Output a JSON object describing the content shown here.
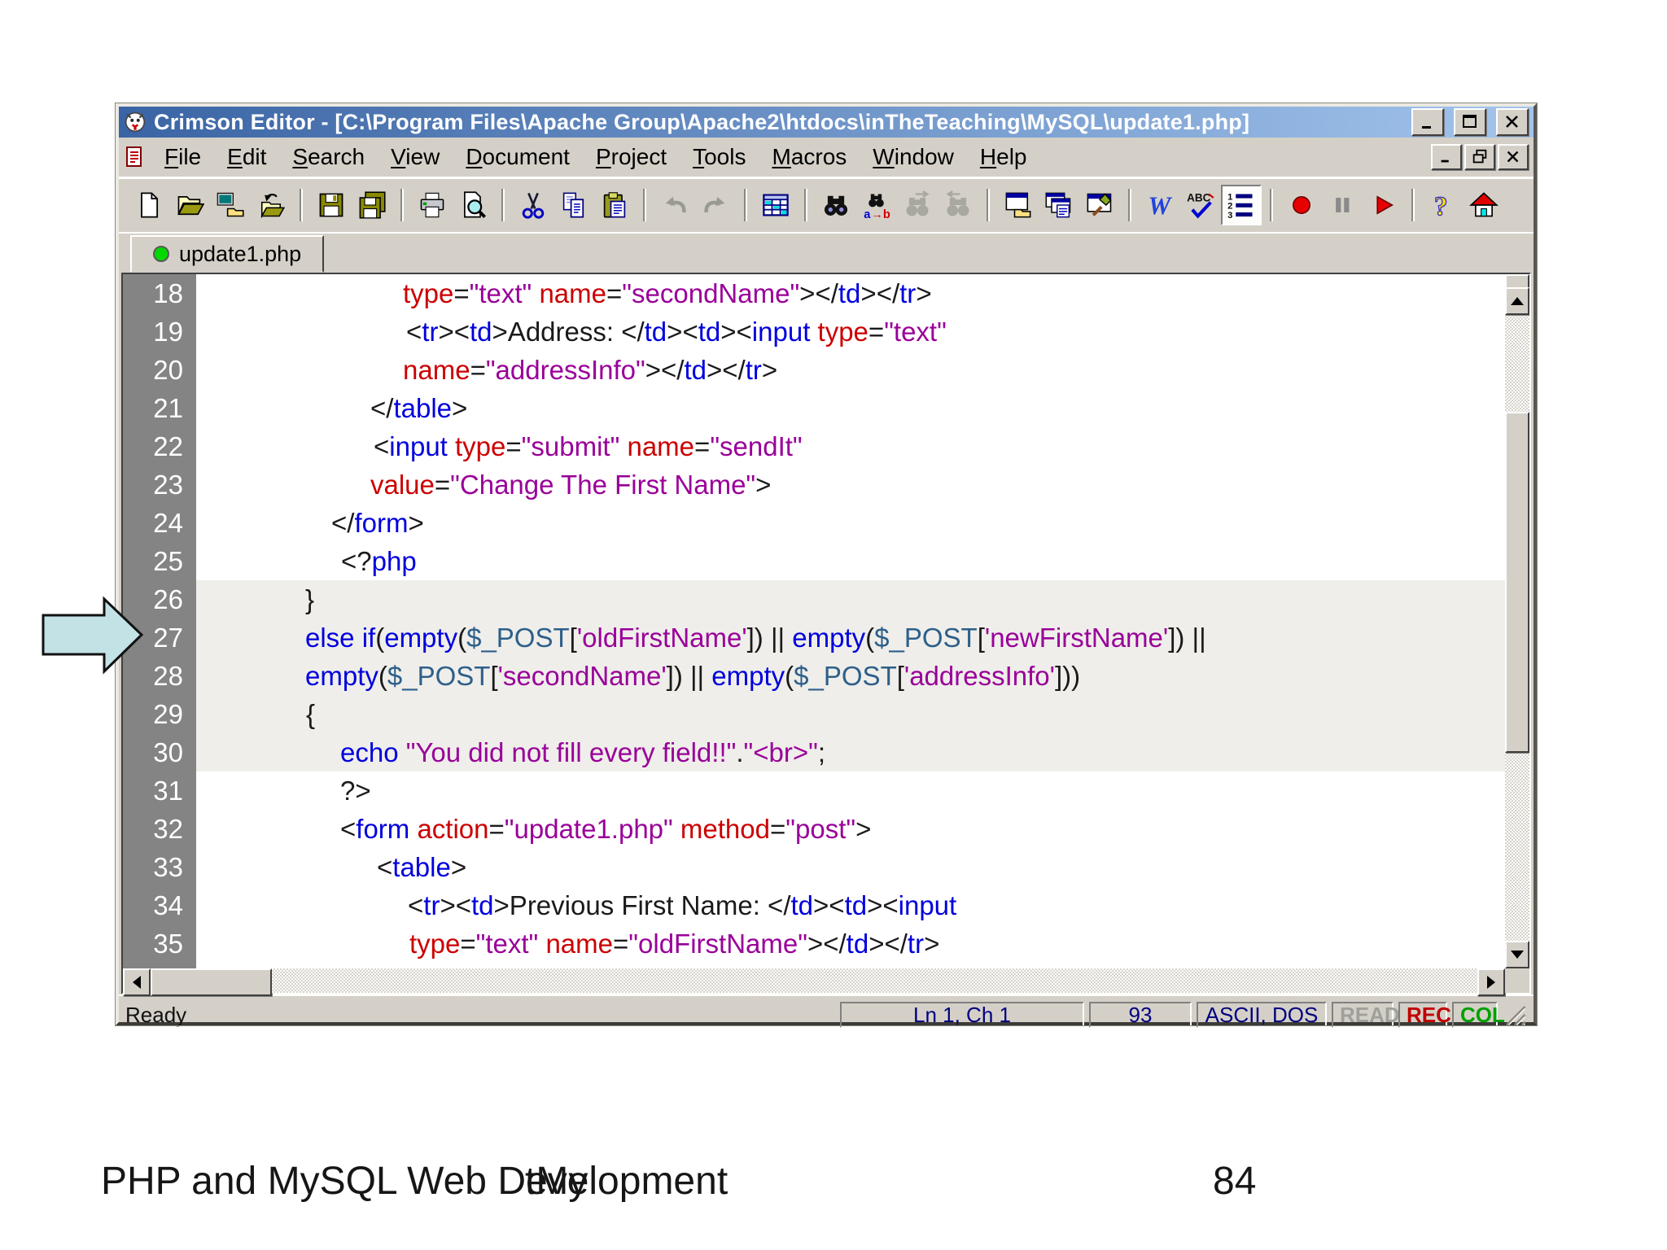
{
  "colors": {
    "title_gradient_left": "#3a64a4",
    "title_gradient_right": "#a2c4ec",
    "chrome": "#d4d0c8",
    "gutter": "#848484",
    "shaded_row": "#efeeea",
    "arrow_fill": "#c2e2e6",
    "tab_dot": "#00d800",
    "status_text": "#000080",
    "tokens": {
      "k": "#0000dd",
      "a": "#cc0000",
      "s": "#990099",
      "p": "#1a1a1a",
      "v": "#2d5f8a"
    },
    "flags": {
      "READ": "#a0a09a",
      "REC": "#c00000",
      "COL": "#00a000"
    }
  },
  "window": {
    "title": "Crimson Editor - [C:\\Program Files\\Apache Group\\Apache2\\htdocs\\inTheTeaching\\MySQL\\update1.php]",
    "title_buttons": [
      "minimize",
      "maximize",
      "close"
    ],
    "child_buttons": [
      "minimize",
      "restore",
      "close"
    ],
    "menus": [
      "File",
      "Edit",
      "Search",
      "View",
      "Document",
      "Project",
      "Tools",
      "Macros",
      "Window",
      "Help"
    ],
    "toolbar": [
      {
        "icon": "new-file"
      },
      {
        "icon": "open-file"
      },
      {
        "icon": "open-remote"
      },
      {
        "icon": "close-folder"
      },
      {
        "separator": true
      },
      {
        "icon": "save"
      },
      {
        "icon": "save-all"
      },
      {
        "separator": true
      },
      {
        "icon": "print"
      },
      {
        "icon": "print-preview"
      },
      {
        "separator": true
      },
      {
        "icon": "cut"
      },
      {
        "icon": "copy"
      },
      {
        "icon": "paste"
      },
      {
        "separator": true
      },
      {
        "icon": "undo",
        "disabled": true
      },
      {
        "icon": "redo",
        "disabled": true
      },
      {
        "separator": true
      },
      {
        "icon": "grid"
      },
      {
        "separator": true
      },
      {
        "icon": "find"
      },
      {
        "icon": "replace"
      },
      {
        "icon": "find-next",
        "disabled": true
      },
      {
        "icon": "find-prev",
        "disabled": true
      },
      {
        "separator": true
      },
      {
        "icon": "project-window"
      },
      {
        "icon": "output-window"
      },
      {
        "icon": "tools-window"
      },
      {
        "separator": true
      },
      {
        "icon": "word-wrap"
      },
      {
        "icon": "spell-check"
      },
      {
        "icon": "line-numbers",
        "pressed": true
      },
      {
        "separator": true
      },
      {
        "icon": "record-macro"
      },
      {
        "icon": "pause-macro",
        "disabled": true
      },
      {
        "icon": "play-macro"
      },
      {
        "separator": true
      },
      {
        "icon": "help"
      },
      {
        "icon": "home"
      }
    ],
    "tab": {
      "label": "update1.php"
    },
    "editor": {
      "lines": [
        {
          "n": 18,
          "indent": 254,
          "shaded": false,
          "tokens": [
            [
              "a",
              "type"
            ],
            [
              "p",
              "="
            ],
            [
              "s",
              "\"text\""
            ],
            [
              "p",
              " "
            ],
            [
              "a",
              "name"
            ],
            [
              "p",
              "="
            ],
            [
              "s",
              "\"secondName\""
            ],
            [
              "p",
              "></"
            ],
            [
              "k",
              "td"
            ],
            [
              "p",
              "></"
            ],
            [
              "k",
              "tr"
            ],
            [
              "p",
              ">"
            ]
          ]
        },
        {
          "n": 19,
          "indent": 258,
          "shaded": false,
          "tokens": [
            [
              "p",
              "<"
            ],
            [
              "k",
              "tr"
            ],
            [
              "p",
              "><"
            ],
            [
              "k",
              "td"
            ],
            [
              "p",
              ">Address: </"
            ],
            [
              "k",
              "td"
            ],
            [
              "p",
              "><"
            ],
            [
              "k",
              "td"
            ],
            [
              "p",
              "><"
            ],
            [
              "k",
              "input"
            ],
            [
              "p",
              " "
            ],
            [
              "a",
              "type"
            ],
            [
              "p",
              "="
            ],
            [
              "s",
              "\"text\""
            ]
          ]
        },
        {
          "n": 20,
          "indent": 254,
          "shaded": false,
          "tokens": [
            [
              "a",
              "name"
            ],
            [
              "p",
              "="
            ],
            [
              "s",
              "\"addressInfo\""
            ],
            [
              "p",
              "></"
            ],
            [
              "k",
              "td"
            ],
            [
              "p",
              "></"
            ],
            [
              "k",
              "tr"
            ],
            [
              "p",
              ">"
            ]
          ]
        },
        {
          "n": 21,
          "indent": 214,
          "shaded": false,
          "tokens": [
            [
              "p",
              "</"
            ],
            [
              "k",
              "table"
            ],
            [
              "p",
              ">"
            ]
          ]
        },
        {
          "n": 22,
          "indent": 218,
          "shaded": false,
          "tokens": [
            [
              "p",
              "<"
            ],
            [
              "k",
              "input"
            ],
            [
              "p",
              " "
            ],
            [
              "a",
              "type"
            ],
            [
              "p",
              "="
            ],
            [
              "s",
              "\"submit\""
            ],
            [
              "p",
              " "
            ],
            [
              "a",
              "name"
            ],
            [
              "p",
              "="
            ],
            [
              "s",
              "\"sendIt\""
            ]
          ]
        },
        {
          "n": 23,
          "indent": 214,
          "shaded": false,
          "tokens": [
            [
              "a",
              "value"
            ],
            [
              "p",
              "="
            ],
            [
              "s",
              "\"Change The First Name\""
            ],
            [
              "p",
              ">"
            ]
          ]
        },
        {
          "n": 24,
          "indent": 166,
          "shaded": false,
          "tokens": [
            [
              "p",
              "</"
            ],
            [
              "k",
              "form"
            ],
            [
              "p",
              ">"
            ]
          ]
        },
        {
          "n": 25,
          "indent": 178,
          "shaded": false,
          "tokens": [
            [
              "p",
              "<?"
            ],
            [
              "k",
              "php"
            ]
          ]
        },
        {
          "n": 26,
          "indent": 134,
          "shaded": true,
          "tokens": [
            [
              "p",
              "}"
            ]
          ]
        },
        {
          "n": 27,
          "indent": 134,
          "shaded": true,
          "tokens": [
            [
              "k",
              "else if"
            ],
            [
              "p",
              "("
            ],
            [
              "k",
              "empty"
            ],
            [
              "p",
              "("
            ],
            [
              "v",
              "$_POST"
            ],
            [
              "p",
              "["
            ],
            [
              "s",
              "'oldFirstName'"
            ],
            [
              "p",
              "]) || "
            ],
            [
              "k",
              "empty"
            ],
            [
              "p",
              "("
            ],
            [
              "v",
              "$_POST"
            ],
            [
              "p",
              "["
            ],
            [
              "s",
              "'newFirstName'"
            ],
            [
              "p",
              "]) ||"
            ]
          ]
        },
        {
          "n": 28,
          "indent": 134,
          "shaded": true,
          "tokens": [
            [
              "k",
              "empty"
            ],
            [
              "p",
              "("
            ],
            [
              "v",
              "$_POST"
            ],
            [
              "p",
              "["
            ],
            [
              "s",
              "'secondName'"
            ],
            [
              "p",
              "]) || "
            ],
            [
              "k",
              "empty"
            ],
            [
              "p",
              "("
            ],
            [
              "v",
              "$_POST"
            ],
            [
              "p",
              "["
            ],
            [
              "s",
              "'addressInfo'"
            ],
            [
              "p",
              "]))"
            ]
          ]
        },
        {
          "n": 29,
          "indent": 135,
          "shaded": true,
          "tokens": [
            [
              "p",
              "{"
            ]
          ]
        },
        {
          "n": 30,
          "indent": 177,
          "shaded": true,
          "tokens": [
            [
              "k",
              "echo"
            ],
            [
              "p",
              " "
            ],
            [
              "s",
              "\"You did not fill every field!!\""
            ],
            [
              "p",
              "."
            ],
            [
              "s",
              "\"<br>\""
            ],
            [
              "p",
              ";"
            ]
          ]
        },
        {
          "n": 31,
          "indent": 177,
          "shaded": false,
          "tokens": [
            [
              "p",
              "?>"
            ]
          ]
        },
        {
          "n": 32,
          "indent": 177,
          "shaded": false,
          "tokens": [
            [
              "p",
              "<"
            ],
            [
              "k",
              "form"
            ],
            [
              "p",
              " "
            ],
            [
              "a",
              "action"
            ],
            [
              "p",
              "="
            ],
            [
              "s",
              "\"update1.php\""
            ],
            [
              "p",
              " "
            ],
            [
              "a",
              "method"
            ],
            [
              "p",
              "="
            ],
            [
              "s",
              "\"post\""
            ],
            [
              "p",
              ">"
            ]
          ]
        },
        {
          "n": 33,
          "indent": 222,
          "shaded": false,
          "tokens": [
            [
              "p",
              "<"
            ],
            [
              "k",
              "table"
            ],
            [
              "p",
              ">"
            ]
          ]
        },
        {
          "n": 34,
          "indent": 260,
          "shaded": false,
          "tokens": [
            [
              "p",
              "<"
            ],
            [
              "k",
              "tr"
            ],
            [
              "p",
              "><"
            ],
            [
              "k",
              "td"
            ],
            [
              "p",
              ">Previous First Name: </"
            ],
            [
              "k",
              "td"
            ],
            [
              "p",
              "><"
            ],
            [
              "k",
              "td"
            ],
            [
              "p",
              "><"
            ],
            [
              "k",
              "input"
            ]
          ]
        },
        {
          "n": 35,
          "indent": 262,
          "shaded": false,
          "tokens": [
            [
              "a",
              "type"
            ],
            [
              "p",
              "="
            ],
            [
              "s",
              "\"text\""
            ],
            [
              "p",
              " "
            ],
            [
              "a",
              "name"
            ],
            [
              "p",
              "="
            ],
            [
              "s",
              "\"oldFirstName\""
            ],
            [
              "p",
              "></"
            ],
            [
              "k",
              "td"
            ],
            [
              "p",
              "></"
            ],
            [
              "k",
              "tr"
            ],
            [
              "p",
              ">"
            ]
          ]
        }
      ]
    },
    "statusbar": {
      "ready": "Ready",
      "panels": [
        "Ln 1, Ch 1",
        "93",
        "ASCII, DOS"
      ],
      "flags": [
        "READ",
        "REC",
        "COL"
      ]
    }
  },
  "annotation_arrow": {
    "points_to_line": 27
  },
  "footer": {
    "left_text": "PHP and MySQL Web Development",
    "overlay_text": "tMy",
    "page_number": "84"
  }
}
